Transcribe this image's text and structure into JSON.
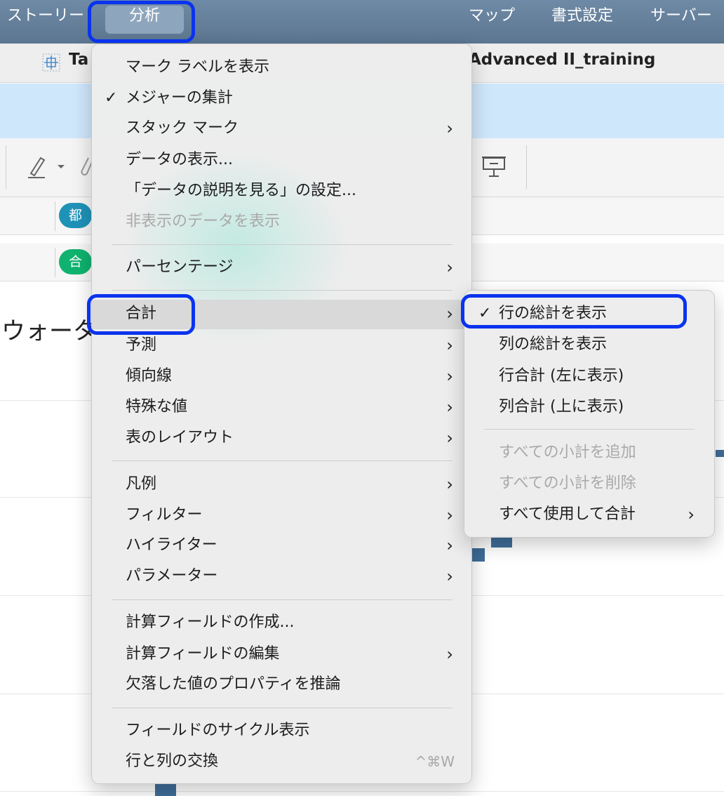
{
  "menubar": {
    "story": "ストーリー",
    "analysis": "分析",
    "map": "マップ",
    "format": "書式設定",
    "server": "サーバー"
  },
  "tabbar": {
    "title_left": "Ta",
    "title_right": "Advanced II_training"
  },
  "shelves": {
    "columns_pill": "都",
    "rows_pill": "合"
  },
  "canvas": {
    "title": "ウォータ"
  },
  "analysis_menu": {
    "items": [
      {
        "label": "マーク ラベルを表示"
      },
      {
        "label": "メジャーの集計",
        "check": "✓"
      },
      {
        "label": "スタック マーク",
        "arrow": "›"
      },
      {
        "label": "データの表示..."
      },
      {
        "label": "「データの説明を見る」の設定..."
      },
      {
        "label": "非表示のデータを表示"
      },
      {
        "label": "パーセンテージ",
        "arrow": "›"
      },
      {
        "label": "合計",
        "arrow": "›"
      },
      {
        "label": "予測",
        "arrow": "›"
      },
      {
        "label": "傾向線",
        "arrow": "›"
      },
      {
        "label": "特殊な値",
        "arrow": "›"
      },
      {
        "label": "表のレイアウト",
        "arrow": "›"
      },
      {
        "label": "凡例",
        "arrow": "›"
      },
      {
        "label": "フィルター",
        "arrow": "›"
      },
      {
        "label": "ハイライター",
        "arrow": "›"
      },
      {
        "label": "パラメーター",
        "arrow": "›"
      },
      {
        "label": "計算フィールドの作成..."
      },
      {
        "label": "計算フィールドの編集",
        "arrow": "›"
      },
      {
        "label": "欠落した値のプロパティを推論"
      },
      {
        "label": "フィールドのサイクル表示"
      },
      {
        "label": "行と列の交換",
        "shortcut": "^⌘W"
      }
    ]
  },
  "totals_submenu": {
    "items": [
      {
        "label": "行の総計を表示",
        "check": "✓"
      },
      {
        "label": "列の総計を表示"
      },
      {
        "label": "行合計 (左に表示)"
      },
      {
        "label": "列合計 (上に表示)"
      },
      {
        "label": "すべての小計を追加"
      },
      {
        "label": "すべての小計を削除"
      },
      {
        "label": "すべて使用して合計",
        "arrow": "›"
      }
    ]
  },
  "icons": {
    "datasource": "datasource-icon",
    "highlighter": "pen-icon",
    "presentation": "presentation-icon"
  },
  "colors": {
    "menubar": "#5c7690",
    "highlight_ring": "#0a33ee",
    "bar": "#3f6d98"
  }
}
